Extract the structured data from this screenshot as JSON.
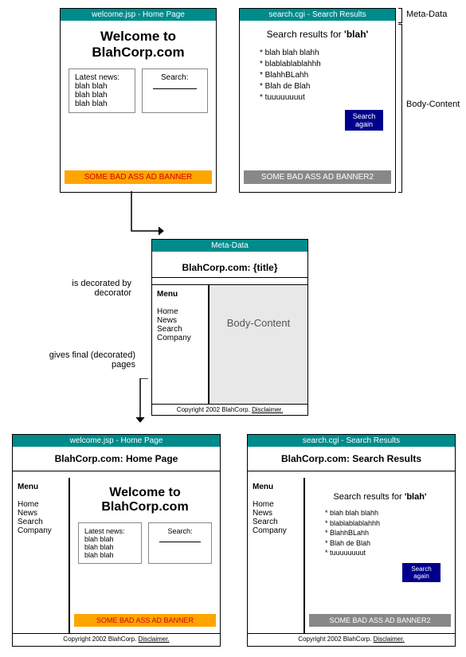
{
  "topLeft": {
    "title": "welcome.jsp - Home Page",
    "heading": "Welcome to BlahCorp.com",
    "news": "Latest news:\nblah blah\nblah blah\nblah blah",
    "search": "Search:",
    "ad": "SOME BAD ASS AD BANNER"
  },
  "topRight": {
    "title": "search.cgi - Search Results",
    "heading": "Search results for 'blah'",
    "r1": "* blah blah blahh",
    "r2": "* blablablablahhh",
    "r3": "* BlahhBLahh",
    "r4": "* Blah de Blah",
    "r5": "* tuuuuuuuut",
    "btn": "Search again",
    "ad": "SOME BAD ASS AD BANNER2"
  },
  "mid": {
    "title": "Meta-Data",
    "heading": "BlahCorp.com: {title}",
    "menuTitle": "Menu",
    "m1": "Home",
    "m2": "News",
    "m3": "Search",
    "m4": "Company",
    "body": "Body-Content",
    "footer": "Copyright 2002 BlahCorp. ",
    "disc": "Disclaimer."
  },
  "botLeft": {
    "title": "welcome.jsp - Home Page",
    "heading": "BlahCorp.com: Home Page"
  },
  "botRight": {
    "title": "search.cgi - Search Results",
    "heading": "BlahCorp.com: Search Results"
  },
  "labels": {
    "l1": "is decorated by decorator",
    "l2": "gives final (decorated) pages",
    "meta": "Meta-Data",
    "bc": "Body-Content"
  }
}
